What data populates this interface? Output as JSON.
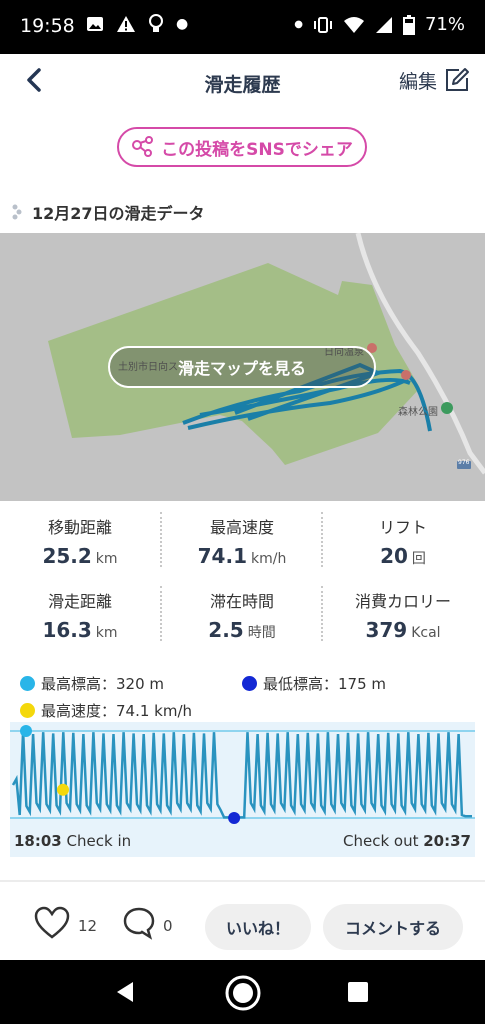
{
  "status_bar": {
    "time": "19:58",
    "battery": "71%"
  },
  "header": {
    "title": "滑走履歴",
    "edit_label": "編集"
  },
  "share_button": {
    "label": "この投稿をSNSでシェア"
  },
  "section": {
    "title": "12月27日の滑走データ"
  },
  "map": {
    "button_label": "滑走マップを見る",
    "labels": [
      "土別市日向ス",
      "日向温泉",
      "森林公園",
      "976"
    ]
  },
  "stats": [
    {
      "label": "移動距離",
      "value": "25.2",
      "unit": "km"
    },
    {
      "label": "最高速度",
      "value": "74.1",
      "unit": "km/h"
    },
    {
      "label": "リフト",
      "value": "20",
      "unit": "回"
    },
    {
      "label": "滑走距離",
      "value": "16.3",
      "unit": "km"
    },
    {
      "label": "滞在時間",
      "value": "2.5",
      "unit": "時間"
    },
    {
      "label": "消費カロリー",
      "value": "379",
      "unit": "Kcal"
    }
  ],
  "legend": {
    "max_altitude": "最高標高：320 m",
    "min_altitude": "最低標高：175 m",
    "max_speed": "最高速度：74.1 km/h"
  },
  "chart_data": {
    "type": "line",
    "series": [
      {
        "values": [
          230,
          240,
          180,
          320,
          195,
          185,
          315,
          200,
          190,
          318,
          198,
          188,
          316,
          196,
          186,
          318,
          200,
          190,
          317,
          198,
          188,
          315,
          196,
          186,
          318,
          200,
          190,
          316,
          198,
          188,
          315,
          196,
          186,
          318,
          200,
          190,
          316,
          198,
          188,
          315,
          196,
          186,
          317,
          198,
          188,
          316,
          196,
          186,
          318,
          200,
          190,
          315,
          200,
          190,
          317,
          196,
          186,
          316,
          200,
          190,
          318,
          198,
          188,
          176,
          176,
          176,
          176,
          176,
          176,
          176,
          318,
          200,
          190,
          315,
          196,
          186,
          317,
          198,
          188,
          316,
          200,
          190,
          318,
          196,
          186,
          315,
          198,
          188,
          317,
          200,
          190,
          316,
          196,
          186,
          318,
          198,
          188,
          315,
          200,
          190,
          317,
          196,
          186,
          316,
          198,
          188,
          318,
          200,
          190,
          315,
          196,
          186,
          317,
          198,
          188,
          316,
          196,
          186,
          318,
          200,
          190,
          315,
          198,
          188,
          317,
          196,
          186,
          316,
          200,
          190,
          318,
          198,
          188,
          315,
          180,
          178,
          178,
          178
        ]
      }
    ],
    "max_altitude": 320,
    "min_altitude": 175,
    "max_speed": 74.1,
    "ylim": [
      160,
      335
    ],
    "colors": {
      "line": "#2a93bf",
      "fill": "#e7f3fb",
      "max": "#29b5e8",
      "min": "#1328d4",
      "speed": "#f4d80c"
    }
  },
  "checkin": {
    "time": "18:03",
    "label": "Check in"
  },
  "checkout": {
    "label": "Check out",
    "time": "20:37"
  },
  "actions": {
    "likes": "12",
    "comments": "0",
    "like_button": "いいね！",
    "comment_button": "コメントする"
  }
}
